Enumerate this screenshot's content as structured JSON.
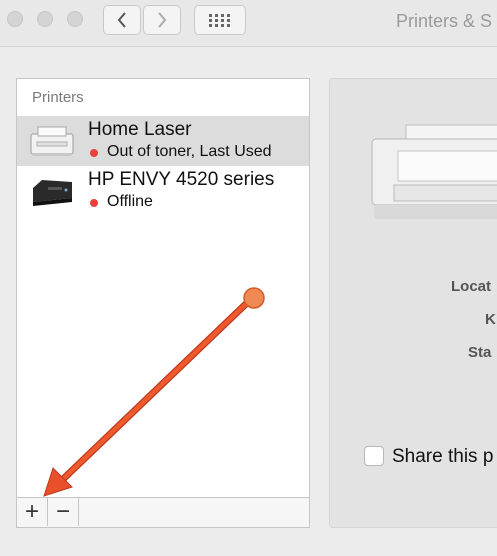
{
  "window": {
    "title": "Printers & S"
  },
  "printers_list": {
    "header": "Printers",
    "items": [
      {
        "name": "Home Laser",
        "status": "Out of toner, Last Used",
        "status_color": "#e8403a",
        "selected": true
      },
      {
        "name": "HP ENVY 4520 series",
        "status": "Offline",
        "status_color": "#e8403a",
        "selected": false
      }
    ]
  },
  "toolbar": {
    "add_label": "+",
    "remove_label": "−"
  },
  "details": {
    "location_label": "Locat",
    "kind_label": "K",
    "status_label": "Sta",
    "share_label": "Share this p"
  },
  "annotation": {
    "arrow_color": "#e8502a",
    "target": "add-printer-button"
  }
}
